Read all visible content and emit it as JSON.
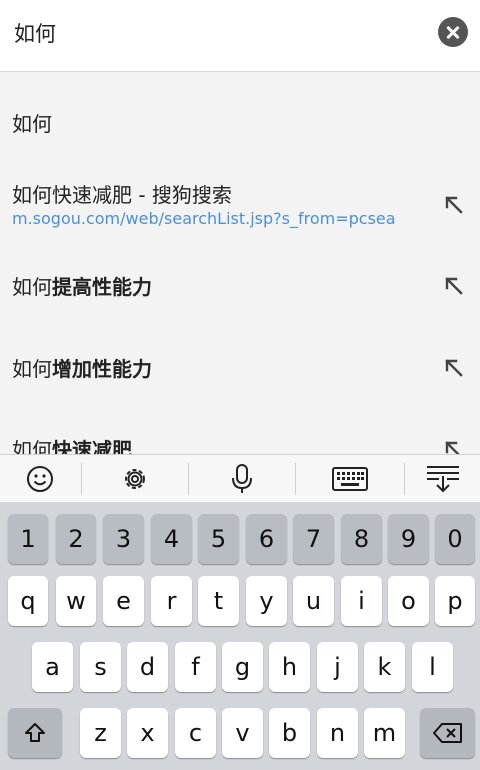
{
  "search": {
    "query": "如何"
  },
  "suggestions": [
    {
      "plain": "如何",
      "bold": ""
    },
    {
      "title": "如何快速减肥 - 搜狗搜索",
      "url": "m.sogou.com/web/searchList.jsp?s_from=pcsea"
    },
    {
      "plain": "如何",
      "bold": "提高性能力"
    },
    {
      "plain": "如何",
      "bold": "增加性能力"
    },
    {
      "plain": "如何",
      "bold": "快速减肥"
    }
  ],
  "keyboard": {
    "toolbar": [
      "emoji-icon",
      "settings-icon",
      "microphone-icon",
      "keyboard-icon",
      "hide-keyboard-icon"
    ],
    "numbers": [
      "1",
      "2",
      "3",
      "4",
      "5",
      "6",
      "7",
      "8",
      "9",
      "0"
    ],
    "row1": [
      "q",
      "w",
      "e",
      "r",
      "t",
      "y",
      "u",
      "i",
      "o",
      "p"
    ],
    "row2": [
      "a",
      "s",
      "d",
      "f",
      "g",
      "h",
      "j",
      "k",
      "l"
    ],
    "row3": [
      "z",
      "x",
      "c",
      "v",
      "b",
      "n",
      "m"
    ]
  },
  "colors": {
    "accent_link": "#4a8fd8",
    "key_bg": "#ffffff",
    "keyboard_bg": "#d2d5da"
  }
}
